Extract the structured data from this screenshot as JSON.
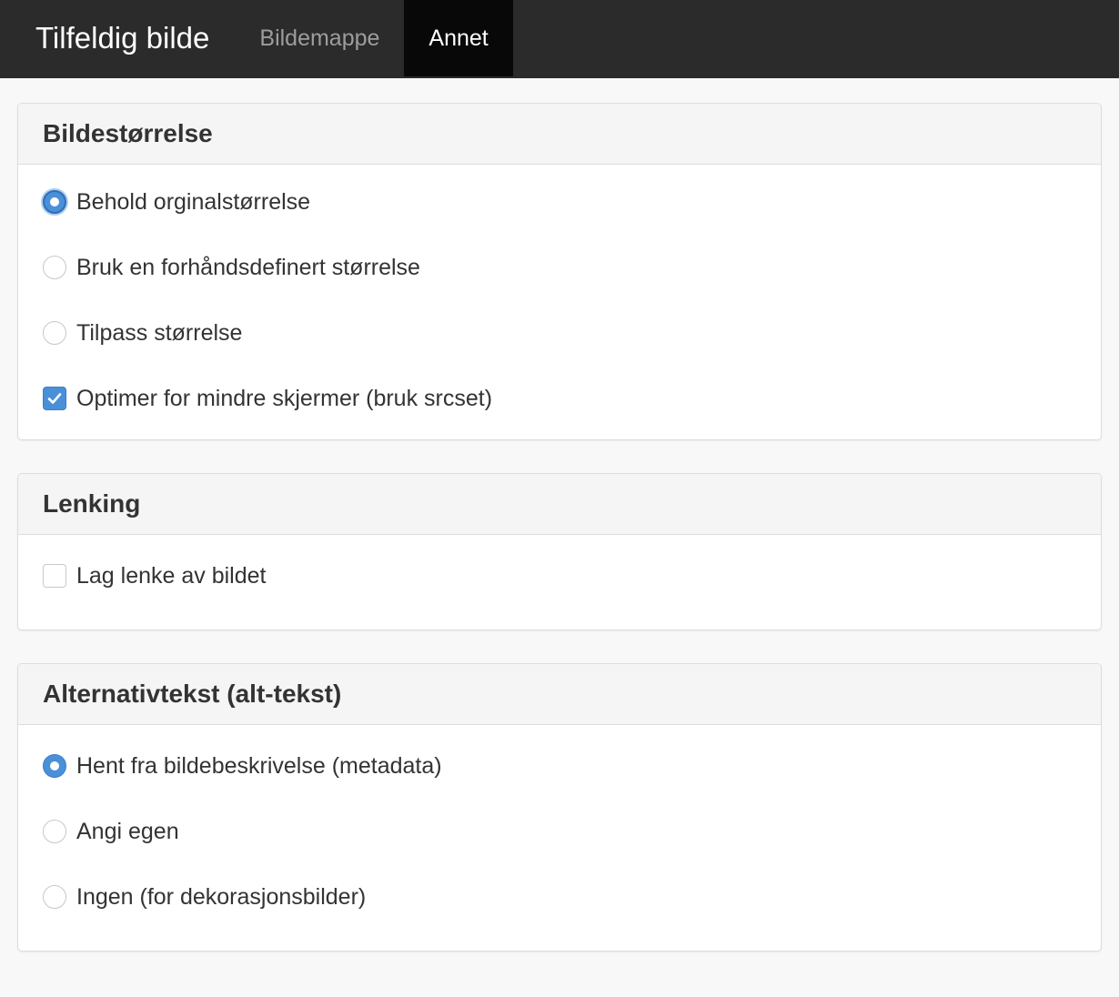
{
  "navbar": {
    "brand": "Tilfeldig bilde",
    "tabs": [
      {
        "label": "Bildemappe",
        "active": false
      },
      {
        "label": "Annet",
        "active": true
      }
    ]
  },
  "panels": {
    "size": {
      "title": "Bildestørrelse",
      "options": [
        {
          "label": "Behold orginalstørrelse",
          "type": "radio",
          "checked": true
        },
        {
          "label": "Bruk en forhåndsdefinert størrelse",
          "type": "radio",
          "checked": false
        },
        {
          "label": "Tilpass størrelse",
          "type": "radio",
          "checked": false
        },
        {
          "label": "Optimer for mindre skjermer (bruk srcset)",
          "type": "checkbox",
          "checked": true
        }
      ]
    },
    "linking": {
      "title": "Lenking",
      "options": [
        {
          "label": "Lag lenke av bildet",
          "type": "checkbox",
          "checked": false
        }
      ]
    },
    "alt": {
      "title": "Alternativtekst (alt-tekst)",
      "options": [
        {
          "label": "Hent fra bildebeskrivelse (metadata)",
          "type": "radio",
          "checked": true
        },
        {
          "label": "Angi egen",
          "type": "radio",
          "checked": false
        },
        {
          "label": "Ingen (for dekorasjonsbilder)",
          "type": "radio",
          "checked": false
        }
      ]
    }
  },
  "colors": {
    "navbar_bg": "#2b2b2b",
    "active_tab_bg": "#080808",
    "accent": "#4a90d9"
  }
}
